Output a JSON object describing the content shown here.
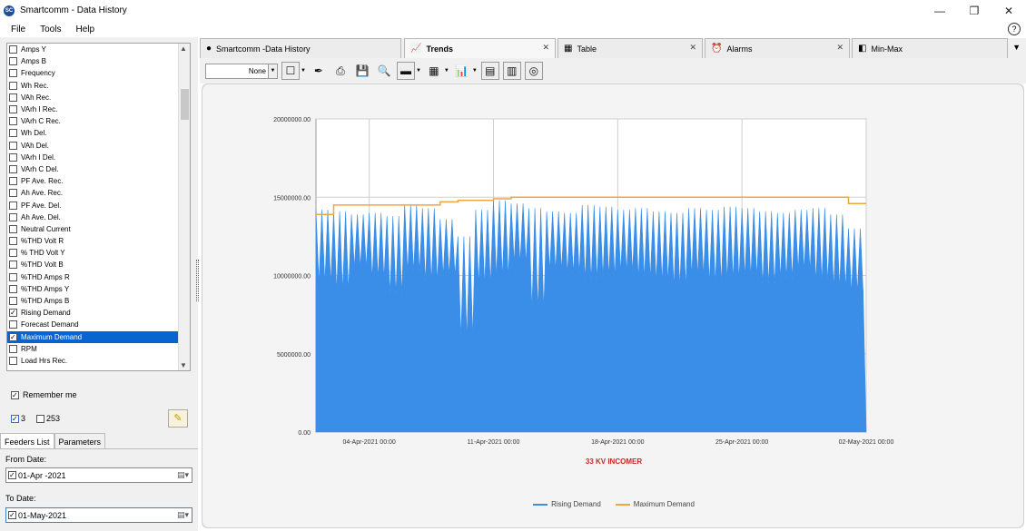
{
  "window": {
    "title": "Smartcomm - Data History",
    "app_icon": "SC",
    "controls": {
      "minimize": "—",
      "restore": "❐",
      "close": "✕"
    }
  },
  "menu": {
    "items": [
      "File",
      "Tools",
      "Help"
    ],
    "help_icon": "?"
  },
  "sidebar": {
    "parameters": [
      {
        "label": "Amps Y",
        "checked": false,
        "selected": false
      },
      {
        "label": "Amps B",
        "checked": false,
        "selected": false
      },
      {
        "label": "Frequency",
        "checked": false,
        "selected": false
      },
      {
        "label": "Wh Rec.",
        "checked": false,
        "selected": false
      },
      {
        "label": "VAh Rec.",
        "checked": false,
        "selected": false
      },
      {
        "label": "VArh I Rec.",
        "checked": false,
        "selected": false
      },
      {
        "label": "VArh C Rec.",
        "checked": false,
        "selected": false
      },
      {
        "label": "Wh Del.",
        "checked": false,
        "selected": false
      },
      {
        "label": "VAh  Del.",
        "checked": false,
        "selected": false
      },
      {
        "label": "VArh I Del.",
        "checked": false,
        "selected": false
      },
      {
        "label": "VArh C Del.",
        "checked": false,
        "selected": false
      },
      {
        "label": "PF Ave. Rec.",
        "checked": false,
        "selected": false
      },
      {
        "label": "Ah Ave. Rec.",
        "checked": false,
        "selected": false
      },
      {
        "label": "PF Ave. Del.",
        "checked": false,
        "selected": false
      },
      {
        "label": "Ah Ave. Del.",
        "checked": false,
        "selected": false
      },
      {
        "label": "Neutral Current",
        "checked": false,
        "selected": false
      },
      {
        "label": "%THD Volt R",
        "checked": false,
        "selected": false
      },
      {
        "label": "% THD Volt Y",
        "checked": false,
        "selected": false
      },
      {
        "label": "%THD Volt B",
        "checked": false,
        "selected": false
      },
      {
        "label": "%THD Amps R",
        "checked": false,
        "selected": false
      },
      {
        "label": "%THD Amps Y",
        "checked": false,
        "selected": false
      },
      {
        "label": "%THD Amps B",
        "checked": false,
        "selected": false
      },
      {
        "label": "Rising Demand",
        "checked": true,
        "selected": false
      },
      {
        "label": "Forecast Demand",
        "checked": false,
        "selected": false
      },
      {
        "label": "Maximum Demand",
        "checked": true,
        "selected": true
      },
      {
        "label": "RPM",
        "checked": false,
        "selected": false
      },
      {
        "label": "Load Hrs Rec.",
        "checked": false,
        "selected": false
      }
    ],
    "remember_me": "Remember me",
    "count_a": "3",
    "count_b": "253",
    "tabs": [
      "Feeders List",
      "Parameters"
    ],
    "from_label": "From Date:",
    "from_value": "01-Apr -2021",
    "to_label": "To Date:",
    "to_value": "01-May-2021"
  },
  "tabs": [
    {
      "label": "Smartcomm -Data History",
      "icon": "●",
      "active": false,
      "closable": false
    },
    {
      "label": "Trends",
      "icon": "📈",
      "active": true,
      "closable": true
    },
    {
      "label": "Table",
      "icon": "▦",
      "active": false,
      "closable": true
    },
    {
      "label": "Alarms",
      "icon": "⏰",
      "active": false,
      "closable": true
    },
    {
      "label": "Min-Max",
      "icon": "◧",
      "active": false,
      "closable": true
    }
  ],
  "toolbar": {
    "style_select": "None"
  },
  "chart_data": {
    "type": "line",
    "title": "33 KV INCOMER",
    "y_ticks": [
      "20000000.00",
      "15000000.00",
      "10000000.00",
      "5000000.00",
      "0.00"
    ],
    "x_ticks": [
      "04-Apr-2021 00:00",
      "11-Apr-2021 00:00",
      "18-Apr-2021 00:00",
      "25-Apr-2021 00:00",
      "02-May-2021 00:00"
    ],
    "ylim": [
      0,
      20000000
    ],
    "xlim": [
      "2021-04-01",
      "2021-05-02"
    ],
    "grid": true,
    "legend_position": "bottom",
    "series": [
      {
        "name": "Rising Demand",
        "color": "#3b8ee8",
        "x": [
          "2021-04-01",
          "2021-04-02",
          "2021-04-03",
          "2021-04-04",
          "2021-04-05",
          "2021-04-06",
          "2021-04-07",
          "2021-04-08",
          "2021-04-09",
          "2021-04-10",
          "2021-04-11",
          "2021-04-12",
          "2021-04-13",
          "2021-04-14",
          "2021-04-15",
          "2021-04-16",
          "2021-04-17",
          "2021-04-18",
          "2021-04-19",
          "2021-04-20",
          "2021-04-21",
          "2021-04-22",
          "2021-04-23",
          "2021-04-24",
          "2021-04-25",
          "2021-04-26",
          "2021-04-27",
          "2021-04-28",
          "2021-04-29",
          "2021-04-30",
          "2021-05-01"
        ],
        "max": [
          14200000,
          14100000,
          13900000,
          14000000,
          13800000,
          14500000,
          14300000,
          13600000,
          12500000,
          14200000,
          14800000,
          14600000,
          14300000,
          14100000,
          14000000,
          14500000,
          14400000,
          14200000,
          14300000,
          14100000,
          14000000,
          14300000,
          14200000,
          14400000,
          14300000,
          14100000,
          14000000,
          14200000,
          14300000,
          13900000,
          13000000
        ],
        "min": [
          9500000,
          9000000,
          10500000,
          9800000,
          8800000,
          10200000,
          9600000,
          10000000,
          6000000,
          9400000,
          9900000,
          10800000,
          7800000,
          10300000,
          10100000,
          9700000,
          9900000,
          10200000,
          9800000,
          9600000,
          9300000,
          10000000,
          9500000,
          9700000,
          9900000,
          9400000,
          9800000,
          10300000,
          9600000,
          9200000,
          8900000
        ]
      },
      {
        "name": "Maximum Demand",
        "color": "#f0a640",
        "x": [
          "2021-04-01",
          "2021-04-02",
          "2021-04-05",
          "2021-04-08",
          "2021-04-09",
          "2021-04-11",
          "2021-04-12",
          "2021-04-30",
          "2021-05-01",
          "2021-05-02"
        ],
        "values": [
          13900000,
          14500000,
          14500000,
          14700000,
          14800000,
          14900000,
          15000000,
          15000000,
          14600000,
          14600000
        ]
      }
    ]
  }
}
